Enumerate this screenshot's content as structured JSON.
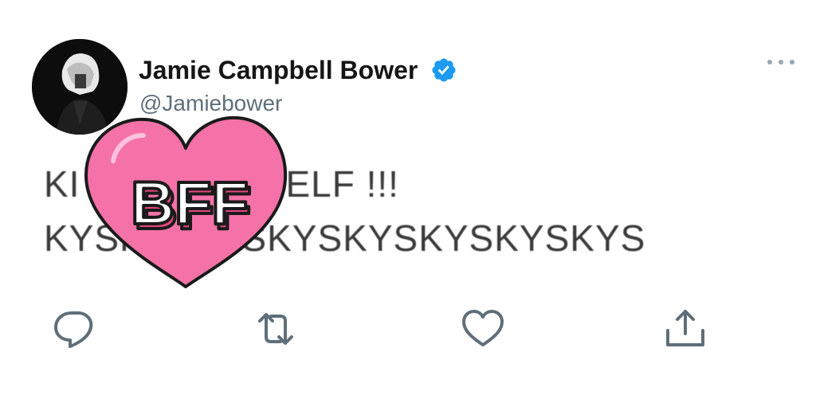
{
  "author": {
    "name": "Jamie Campbell Bower",
    "handle": "@Jamiebower",
    "verified": true
  },
  "tweet": {
    "line1": "KI",
    "line1_end": "ELF !!!",
    "line2": "KYSK",
    "line2_end": "YSKYSKYSKYSKYSKYS"
  },
  "sticker": {
    "text": "BFF",
    "color": "#f472a8"
  },
  "icons": {
    "more": "more-options-icon",
    "reply": "reply-icon",
    "retweet": "retweet-icon",
    "like": "like-icon",
    "share": "share-icon"
  },
  "colors": {
    "verified_blue": "#1d9bf0",
    "icon_gray": "#5f6f79"
  }
}
